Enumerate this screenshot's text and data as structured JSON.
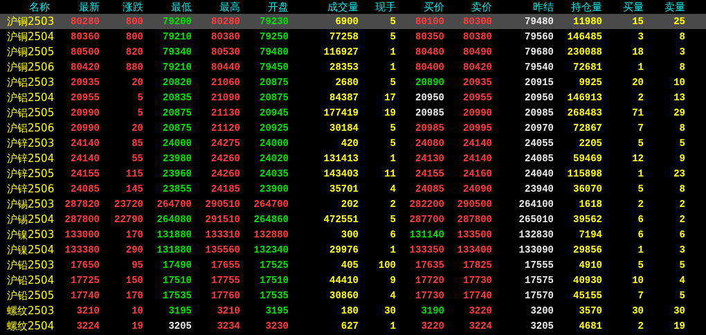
{
  "table": {
    "columns": [
      "名称",
      "最新",
      "涨跌",
      "最低",
      "最高",
      "开盘",
      "成交量",
      "现手",
      "买价",
      "卖价",
      "昨结",
      "持仓量",
      "买量",
      "卖量"
    ],
    "rows": [
      {
        "selected": true,
        "cells": [
          {
            "text": "沪铜2503",
            "kind": "name"
          },
          {
            "text": "80280",
            "kind": "up"
          },
          {
            "text": "800",
            "kind": "up"
          },
          {
            "text": "79200",
            "kind": "down"
          },
          {
            "text": "80280",
            "kind": "up"
          },
          {
            "text": "79230",
            "kind": "down"
          },
          {
            "text": "6900",
            "kind": "qty"
          },
          {
            "text": "5",
            "kind": "qty"
          },
          {
            "text": "80100",
            "kind": "up"
          },
          {
            "text": "80300",
            "kind": "up"
          },
          {
            "text": "79480",
            "kind": "flat"
          },
          {
            "text": "11980",
            "kind": "qty"
          },
          {
            "text": "15",
            "kind": "qty"
          },
          {
            "text": "25",
            "kind": "qty"
          }
        ]
      },
      {
        "selected": false,
        "cells": [
          {
            "text": "沪铜2504",
            "kind": "name"
          },
          {
            "text": "80360",
            "kind": "up"
          },
          {
            "text": "800",
            "kind": "up"
          },
          {
            "text": "79210",
            "kind": "down"
          },
          {
            "text": "80380",
            "kind": "up"
          },
          {
            "text": "79250",
            "kind": "down"
          },
          {
            "text": "77258",
            "kind": "qty"
          },
          {
            "text": "5",
            "kind": "qty"
          },
          {
            "text": "80350",
            "kind": "up"
          },
          {
            "text": "80380",
            "kind": "up"
          },
          {
            "text": "79560",
            "kind": "flat"
          },
          {
            "text": "146485",
            "kind": "qty"
          },
          {
            "text": "3",
            "kind": "qty"
          },
          {
            "text": "8",
            "kind": "qty"
          }
        ]
      },
      {
        "selected": false,
        "cells": [
          {
            "text": "沪铜2505",
            "kind": "name"
          },
          {
            "text": "80500",
            "kind": "up"
          },
          {
            "text": "820",
            "kind": "up"
          },
          {
            "text": "79340",
            "kind": "down"
          },
          {
            "text": "80530",
            "kind": "up"
          },
          {
            "text": "79480",
            "kind": "down"
          },
          {
            "text": "116927",
            "kind": "qty"
          },
          {
            "text": "1",
            "kind": "qty"
          },
          {
            "text": "80480",
            "kind": "up"
          },
          {
            "text": "80490",
            "kind": "up"
          },
          {
            "text": "79680",
            "kind": "flat"
          },
          {
            "text": "230088",
            "kind": "qty"
          },
          {
            "text": "18",
            "kind": "qty"
          },
          {
            "text": "3",
            "kind": "qty"
          }
        ]
      },
      {
        "selected": false,
        "cells": [
          {
            "text": "沪铜2506",
            "kind": "name"
          },
          {
            "text": "80420",
            "kind": "up"
          },
          {
            "text": "880",
            "kind": "up"
          },
          {
            "text": "79210",
            "kind": "down"
          },
          {
            "text": "80440",
            "kind": "up"
          },
          {
            "text": "79450",
            "kind": "down"
          },
          {
            "text": "28353",
            "kind": "qty"
          },
          {
            "text": "1",
            "kind": "qty"
          },
          {
            "text": "80400",
            "kind": "up"
          },
          {
            "text": "80420",
            "kind": "up"
          },
          {
            "text": "79540",
            "kind": "flat"
          },
          {
            "text": "72681",
            "kind": "qty"
          },
          {
            "text": "1",
            "kind": "qty"
          },
          {
            "text": "8",
            "kind": "qty"
          }
        ]
      },
      {
        "selected": false,
        "cells": [
          {
            "text": "沪铝2503",
            "kind": "name"
          },
          {
            "text": "20935",
            "kind": "up"
          },
          {
            "text": "20",
            "kind": "up"
          },
          {
            "text": "20820",
            "kind": "down"
          },
          {
            "text": "21060",
            "kind": "up"
          },
          {
            "text": "20875",
            "kind": "down"
          },
          {
            "text": "2680",
            "kind": "qty"
          },
          {
            "text": "5",
            "kind": "qty"
          },
          {
            "text": "20890",
            "kind": "down"
          },
          {
            "text": "20935",
            "kind": "up"
          },
          {
            "text": "20915",
            "kind": "flat"
          },
          {
            "text": "9925",
            "kind": "qty"
          },
          {
            "text": "20",
            "kind": "qty"
          },
          {
            "text": "10",
            "kind": "qty"
          }
        ]
      },
      {
        "selected": false,
        "cells": [
          {
            "text": "沪铝2504",
            "kind": "name"
          },
          {
            "text": "20955",
            "kind": "up"
          },
          {
            "text": "5",
            "kind": "up"
          },
          {
            "text": "20835",
            "kind": "down"
          },
          {
            "text": "21090",
            "kind": "up"
          },
          {
            "text": "20875",
            "kind": "down"
          },
          {
            "text": "84387",
            "kind": "qty"
          },
          {
            "text": "17",
            "kind": "qty"
          },
          {
            "text": "20950",
            "kind": "flat"
          },
          {
            "text": "20955",
            "kind": "up"
          },
          {
            "text": "20950",
            "kind": "flat"
          },
          {
            "text": "146913",
            "kind": "qty"
          },
          {
            "text": "2",
            "kind": "qty"
          },
          {
            "text": "13",
            "kind": "qty"
          }
        ]
      },
      {
        "selected": false,
        "cells": [
          {
            "text": "沪铝2505",
            "kind": "name"
          },
          {
            "text": "20990",
            "kind": "up"
          },
          {
            "text": "5",
            "kind": "up"
          },
          {
            "text": "20875",
            "kind": "down"
          },
          {
            "text": "21130",
            "kind": "up"
          },
          {
            "text": "20945",
            "kind": "down"
          },
          {
            "text": "177419",
            "kind": "qty"
          },
          {
            "text": "19",
            "kind": "qty"
          },
          {
            "text": "20985",
            "kind": "flat"
          },
          {
            "text": "20990",
            "kind": "up"
          },
          {
            "text": "20985",
            "kind": "flat"
          },
          {
            "text": "268483",
            "kind": "qty"
          },
          {
            "text": "71",
            "kind": "qty"
          },
          {
            "text": "29",
            "kind": "qty"
          }
        ]
      },
      {
        "selected": false,
        "cells": [
          {
            "text": "沪铝2506",
            "kind": "name"
          },
          {
            "text": "20990",
            "kind": "up"
          },
          {
            "text": "20",
            "kind": "up"
          },
          {
            "text": "20875",
            "kind": "down"
          },
          {
            "text": "21120",
            "kind": "up"
          },
          {
            "text": "20925",
            "kind": "down"
          },
          {
            "text": "30184",
            "kind": "qty"
          },
          {
            "text": "5",
            "kind": "qty"
          },
          {
            "text": "20985",
            "kind": "up"
          },
          {
            "text": "20995",
            "kind": "up"
          },
          {
            "text": "20970",
            "kind": "flat"
          },
          {
            "text": "72867",
            "kind": "qty"
          },
          {
            "text": "7",
            "kind": "qty"
          },
          {
            "text": "8",
            "kind": "qty"
          }
        ]
      },
      {
        "selected": false,
        "cells": [
          {
            "text": "沪锌2503",
            "kind": "name"
          },
          {
            "text": "24140",
            "kind": "up"
          },
          {
            "text": "85",
            "kind": "up"
          },
          {
            "text": "24000",
            "kind": "down"
          },
          {
            "text": "24275",
            "kind": "up"
          },
          {
            "text": "24000",
            "kind": "down"
          },
          {
            "text": "420",
            "kind": "qty"
          },
          {
            "text": "5",
            "kind": "qty"
          },
          {
            "text": "24080",
            "kind": "up"
          },
          {
            "text": "24140",
            "kind": "up"
          },
          {
            "text": "24055",
            "kind": "flat"
          },
          {
            "text": "2205",
            "kind": "qty"
          },
          {
            "text": "5",
            "kind": "qty"
          },
          {
            "text": "5",
            "kind": "qty"
          }
        ]
      },
      {
        "selected": false,
        "cells": [
          {
            "text": "沪锌2504",
            "kind": "name"
          },
          {
            "text": "24140",
            "kind": "up"
          },
          {
            "text": "55",
            "kind": "up"
          },
          {
            "text": "23980",
            "kind": "down"
          },
          {
            "text": "24260",
            "kind": "up"
          },
          {
            "text": "24020",
            "kind": "down"
          },
          {
            "text": "131413",
            "kind": "qty"
          },
          {
            "text": "1",
            "kind": "qty"
          },
          {
            "text": "24130",
            "kind": "up"
          },
          {
            "text": "24140",
            "kind": "up"
          },
          {
            "text": "24085",
            "kind": "flat"
          },
          {
            "text": "59469",
            "kind": "qty"
          },
          {
            "text": "12",
            "kind": "qty"
          },
          {
            "text": "9",
            "kind": "qty"
          }
        ]
      },
      {
        "selected": false,
        "cells": [
          {
            "text": "沪锌2505",
            "kind": "name"
          },
          {
            "text": "24155",
            "kind": "up"
          },
          {
            "text": "115",
            "kind": "up"
          },
          {
            "text": "23960",
            "kind": "down"
          },
          {
            "text": "24260",
            "kind": "up"
          },
          {
            "text": "24035",
            "kind": "down"
          },
          {
            "text": "143403",
            "kind": "qty"
          },
          {
            "text": "11",
            "kind": "qty"
          },
          {
            "text": "24155",
            "kind": "up"
          },
          {
            "text": "24160",
            "kind": "up"
          },
          {
            "text": "24040",
            "kind": "flat"
          },
          {
            "text": "115898",
            "kind": "qty"
          },
          {
            "text": "1",
            "kind": "qty"
          },
          {
            "text": "23",
            "kind": "qty"
          }
        ]
      },
      {
        "selected": false,
        "cells": [
          {
            "text": "沪锌2506",
            "kind": "name"
          },
          {
            "text": "24085",
            "kind": "up"
          },
          {
            "text": "145",
            "kind": "up"
          },
          {
            "text": "23855",
            "kind": "down"
          },
          {
            "text": "24185",
            "kind": "up"
          },
          {
            "text": "23900",
            "kind": "down"
          },
          {
            "text": "35701",
            "kind": "qty"
          },
          {
            "text": "4",
            "kind": "qty"
          },
          {
            "text": "24085",
            "kind": "up"
          },
          {
            "text": "24090",
            "kind": "up"
          },
          {
            "text": "23940",
            "kind": "flat"
          },
          {
            "text": "36070",
            "kind": "qty"
          },
          {
            "text": "5",
            "kind": "qty"
          },
          {
            "text": "8",
            "kind": "qty"
          }
        ]
      },
      {
        "selected": false,
        "cells": [
          {
            "text": "沪锡2503",
            "kind": "name"
          },
          {
            "text": "287820",
            "kind": "up"
          },
          {
            "text": "23720",
            "kind": "up"
          },
          {
            "text": "264700",
            "kind": "up"
          },
          {
            "text": "290510",
            "kind": "up"
          },
          {
            "text": "264700",
            "kind": "up"
          },
          {
            "text": "202",
            "kind": "qty"
          },
          {
            "text": "2",
            "kind": "qty"
          },
          {
            "text": "282200",
            "kind": "up"
          },
          {
            "text": "290500",
            "kind": "up"
          },
          {
            "text": "264100",
            "kind": "flat"
          },
          {
            "text": "1618",
            "kind": "qty"
          },
          {
            "text": "2",
            "kind": "qty"
          },
          {
            "text": "2",
            "kind": "qty"
          }
        ]
      },
      {
        "selected": false,
        "cells": [
          {
            "text": "沪锡2504",
            "kind": "name"
          },
          {
            "text": "287800",
            "kind": "up"
          },
          {
            "text": "22790",
            "kind": "up"
          },
          {
            "text": "264080",
            "kind": "down"
          },
          {
            "text": "291510",
            "kind": "up"
          },
          {
            "text": "264860",
            "kind": "down"
          },
          {
            "text": "472551",
            "kind": "qty"
          },
          {
            "text": "5",
            "kind": "qty"
          },
          {
            "text": "287700",
            "kind": "up"
          },
          {
            "text": "287800",
            "kind": "up"
          },
          {
            "text": "265010",
            "kind": "flat"
          },
          {
            "text": "39562",
            "kind": "qty"
          },
          {
            "text": "6",
            "kind": "qty"
          },
          {
            "text": "2",
            "kind": "qty"
          }
        ]
      },
      {
        "selected": false,
        "cells": [
          {
            "text": "沪镍2503",
            "kind": "name"
          },
          {
            "text": "133000",
            "kind": "up"
          },
          {
            "text": "170",
            "kind": "up"
          },
          {
            "text": "131880",
            "kind": "down"
          },
          {
            "text": "133310",
            "kind": "up"
          },
          {
            "text": "132880",
            "kind": "up"
          },
          {
            "text": "300",
            "kind": "qty"
          },
          {
            "text": "6",
            "kind": "qty"
          },
          {
            "text": "131140",
            "kind": "down"
          },
          {
            "text": "133500",
            "kind": "up"
          },
          {
            "text": "132830",
            "kind": "flat"
          },
          {
            "text": "7194",
            "kind": "qty"
          },
          {
            "text": "6",
            "kind": "qty"
          },
          {
            "text": "6",
            "kind": "qty"
          }
        ]
      },
      {
        "selected": false,
        "cells": [
          {
            "text": "沪镍2504",
            "kind": "name"
          },
          {
            "text": "133380",
            "kind": "up"
          },
          {
            "text": "290",
            "kind": "up"
          },
          {
            "text": "131880",
            "kind": "down"
          },
          {
            "text": "135560",
            "kind": "up"
          },
          {
            "text": "132340",
            "kind": "down"
          },
          {
            "text": "29976",
            "kind": "qty"
          },
          {
            "text": "1",
            "kind": "qty"
          },
          {
            "text": "133350",
            "kind": "up"
          },
          {
            "text": "133400",
            "kind": "up"
          },
          {
            "text": "133090",
            "kind": "flat"
          },
          {
            "text": "29856",
            "kind": "qty"
          },
          {
            "text": "1",
            "kind": "qty"
          },
          {
            "text": "3",
            "kind": "qty"
          }
        ]
      },
      {
        "selected": false,
        "cells": [
          {
            "text": "沪铅2503",
            "kind": "name"
          },
          {
            "text": "17650",
            "kind": "up"
          },
          {
            "text": "95",
            "kind": "up"
          },
          {
            "text": "17490",
            "kind": "down"
          },
          {
            "text": "17655",
            "kind": "up"
          },
          {
            "text": "17525",
            "kind": "down"
          },
          {
            "text": "405",
            "kind": "qty"
          },
          {
            "text": "100",
            "kind": "qty"
          },
          {
            "text": "17635",
            "kind": "up"
          },
          {
            "text": "17825",
            "kind": "up"
          },
          {
            "text": "17555",
            "kind": "flat"
          },
          {
            "text": "4910",
            "kind": "qty"
          },
          {
            "text": "5",
            "kind": "qty"
          },
          {
            "text": "5",
            "kind": "qty"
          }
        ]
      },
      {
        "selected": false,
        "cells": [
          {
            "text": "沪铅2504",
            "kind": "name"
          },
          {
            "text": "17725",
            "kind": "up"
          },
          {
            "text": "150",
            "kind": "up"
          },
          {
            "text": "17510",
            "kind": "down"
          },
          {
            "text": "17755",
            "kind": "up"
          },
          {
            "text": "17510",
            "kind": "down"
          },
          {
            "text": "44410",
            "kind": "qty"
          },
          {
            "text": "9",
            "kind": "qty"
          },
          {
            "text": "17720",
            "kind": "up"
          },
          {
            "text": "17730",
            "kind": "up"
          },
          {
            "text": "17575",
            "kind": "flat"
          },
          {
            "text": "40930",
            "kind": "qty"
          },
          {
            "text": "10",
            "kind": "qty"
          },
          {
            "text": "4",
            "kind": "qty"
          }
        ]
      },
      {
        "selected": false,
        "cells": [
          {
            "text": "沪铅2505",
            "kind": "name"
          },
          {
            "text": "17740",
            "kind": "up"
          },
          {
            "text": "170",
            "kind": "up"
          },
          {
            "text": "17535",
            "kind": "down"
          },
          {
            "text": "17760",
            "kind": "up"
          },
          {
            "text": "17535",
            "kind": "down"
          },
          {
            "text": "30860",
            "kind": "qty"
          },
          {
            "text": "4",
            "kind": "qty"
          },
          {
            "text": "17730",
            "kind": "up"
          },
          {
            "text": "17740",
            "kind": "up"
          },
          {
            "text": "17570",
            "kind": "flat"
          },
          {
            "text": "45155",
            "kind": "qty"
          },
          {
            "text": "7",
            "kind": "qty"
          },
          {
            "text": "5",
            "kind": "qty"
          }
        ]
      },
      {
        "selected": false,
        "cells": [
          {
            "text": "螺纹2503",
            "kind": "name"
          },
          {
            "text": "3210",
            "kind": "up"
          },
          {
            "text": "10",
            "kind": "up"
          },
          {
            "text": "3195",
            "kind": "down"
          },
          {
            "text": "3210",
            "kind": "up"
          },
          {
            "text": "3195",
            "kind": "down"
          },
          {
            "text": "180",
            "kind": "qty"
          },
          {
            "text": "30",
            "kind": "qty"
          },
          {
            "text": "3190",
            "kind": "down"
          },
          {
            "text": "3220",
            "kind": "up"
          },
          {
            "text": "3200",
            "kind": "flat"
          },
          {
            "text": "3570",
            "kind": "qty"
          },
          {
            "text": "30",
            "kind": "qty"
          },
          {
            "text": "30",
            "kind": "qty"
          }
        ]
      },
      {
        "selected": false,
        "cells": [
          {
            "text": "螺纹2504",
            "kind": "name"
          },
          {
            "text": "3224",
            "kind": "up"
          },
          {
            "text": "19",
            "kind": "up"
          },
          {
            "text": "3205",
            "kind": "flat"
          },
          {
            "text": "3234",
            "kind": "up"
          },
          {
            "text": "3230",
            "kind": "up"
          },
          {
            "text": "627",
            "kind": "qty"
          },
          {
            "text": "1",
            "kind": "qty"
          },
          {
            "text": "3220",
            "kind": "up"
          },
          {
            "text": "3224",
            "kind": "up"
          },
          {
            "text": "3205",
            "kind": "flat"
          },
          {
            "text": "4681",
            "kind": "qty"
          },
          {
            "text": "2",
            "kind": "qty"
          },
          {
            "text": "19",
            "kind": "qty"
          }
        ]
      }
    ]
  }
}
